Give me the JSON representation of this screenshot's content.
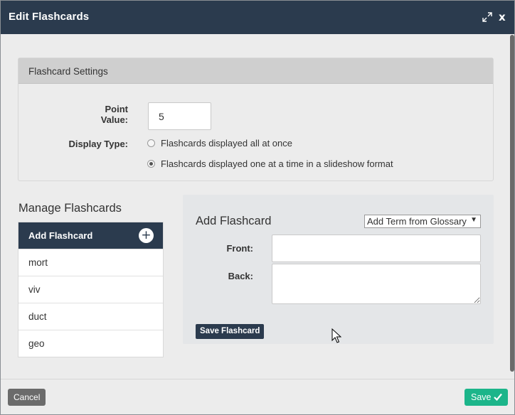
{
  "dialog": {
    "title": "Edit Flashcards",
    "close_glyph": "x"
  },
  "settings": {
    "header": "Flashcard Settings",
    "point_value_label": "Point Value:",
    "point_value": "5",
    "display_type_label": "Display Type:",
    "display_options": [
      {
        "label": "Flashcards displayed all at once",
        "checked": false
      },
      {
        "label": "Flashcards displayed one at a time in a slideshow format",
        "checked": true
      }
    ]
  },
  "manage": {
    "title": "Manage Flashcards",
    "add_label": "Add Flashcard",
    "plus_glyph": "+",
    "items": [
      "mort",
      "viv",
      "duct",
      "geo"
    ]
  },
  "add_form": {
    "title": "Add Flashcard",
    "glossary_select": "Add Term from Glossary",
    "caret_glyph": "▼",
    "front_label": "Front:",
    "front_value": "",
    "back_label": "Back:",
    "back_value": "",
    "save_label": "Save Flashcard"
  },
  "footer": {
    "cancel_label": "Cancel",
    "save_label": "Save"
  },
  "colors": {
    "header_navy": "#2b3b4e",
    "save_green": "#1cb58a",
    "cancel_gray": "#6b6b6b",
    "panel_gray": "#ececec"
  },
  "icons": [
    "expand-icon",
    "close-icon",
    "plus-icon",
    "caret-down-icon",
    "check-icon",
    "mouse-cursor-icon"
  ]
}
